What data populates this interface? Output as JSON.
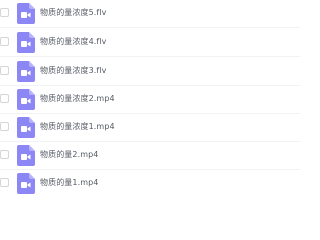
{
  "colors": {
    "icon_fill": "#8c87f4",
    "icon_fold": "#b7b3fb",
    "icon_glyph": "#ffffff",
    "text": "#555a63",
    "divider": "#f1f2f4",
    "checkbox_border": "#d4d6da"
  },
  "icon_name": "video-file-icon",
  "files": [
    {
      "name": "物质的量浓度5.flv"
    },
    {
      "name": "物质的量浓度4.flv"
    },
    {
      "name": "物质的量浓度3.flv"
    },
    {
      "name": "物质的量浓度2.mp4"
    },
    {
      "name": "物质的量浓度1.mp4"
    },
    {
      "name": "物质的量2.mp4"
    },
    {
      "name": "物质的量1.mp4"
    }
  ]
}
